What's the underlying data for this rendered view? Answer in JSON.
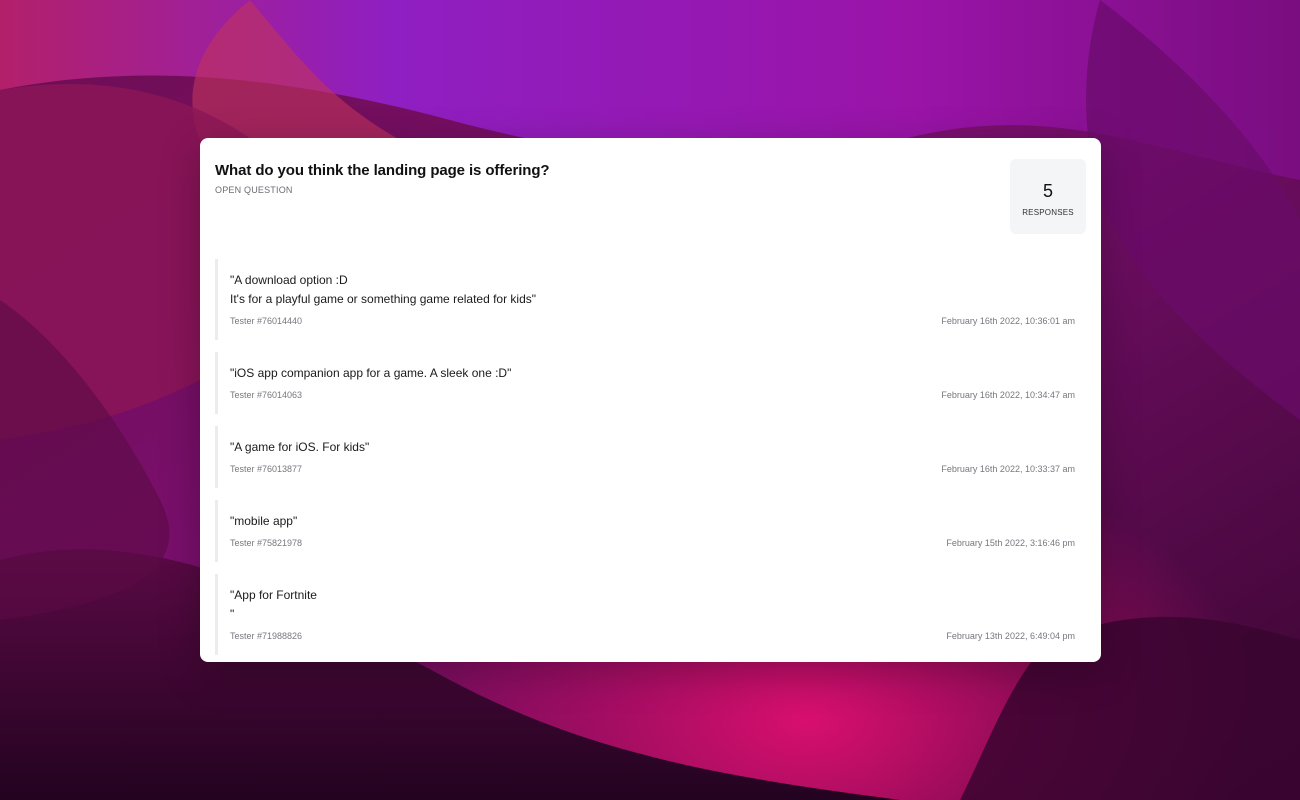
{
  "colors": {
    "wallpaper_primary": "#8e1a8c",
    "wallpaper_accent": "#c20a6a",
    "card_background": "#ffffff",
    "count_box_background": "#f4f5f7",
    "response_border": "#ececef"
  },
  "question": {
    "title": "What do you think the landing page is offering?",
    "type_label": "OPEN QUESTION"
  },
  "summary": {
    "count": "5",
    "count_label": "RESPONSES"
  },
  "responses": [
    {
      "text": "\"A download option :D\nIt's for a playful game or something game related for kids\"",
      "tester": "Tester #76014440",
      "date": "February 16th 2022, 10:36:01 am"
    },
    {
      "text": "\"iOS app companion app for a game. A sleek one :D\"",
      "tester": "Tester #76014063",
      "date": "February 16th 2022, 10:34:47 am"
    },
    {
      "text": "\"A game for iOS. For kids\"",
      "tester": "Tester #76013877",
      "date": "February 16th 2022, 10:33:37 am"
    },
    {
      "text": "\"mobile app\"",
      "tester": "Tester #75821978",
      "date": "February 15th 2022, 3:16:46 pm"
    },
    {
      "text": "\"App for Fortnite\n\"",
      "tester": "Tester #71988826",
      "date": "February 13th 2022, 6:49:04 pm"
    }
  ]
}
